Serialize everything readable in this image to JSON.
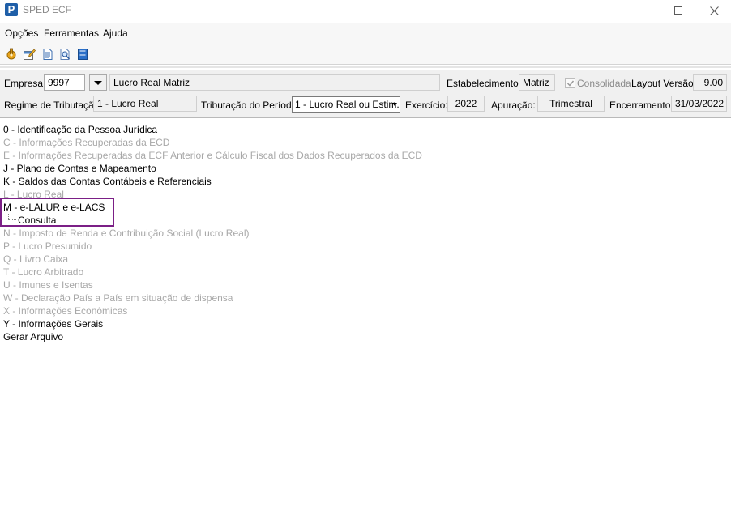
{
  "window": {
    "title": "SPED ECF",
    "app_icon_letter": "P"
  },
  "menu": {
    "items": [
      "Opções",
      "Ferramentas",
      "Ajuda"
    ]
  },
  "toolbar": {
    "icons": [
      "tools-icon",
      "edit-icon",
      "document-icon",
      "search-document-icon",
      "list-icon"
    ]
  },
  "header": {
    "empresa_label": "Empresa:",
    "empresa_code": "9997",
    "empresa_name": "Lucro Real Matriz",
    "estabelecimento_label": "Estabelecimento:",
    "estabelecimento_value": "Matriz",
    "consolidada_label": "Consolidada",
    "consolidada_checked": true,
    "layout_label": "Layout Versão:",
    "layout_value": "9.00",
    "regime_label": "Regime de Tributação:",
    "regime_value": "1 - Lucro Real",
    "tributacao_label": "Tributação do Período:",
    "tributacao_value": "1 - Lucro Real ou Estim.",
    "exercicio_label": "Exercício:",
    "exercicio_value": "2022",
    "apuracao_label": "Apuração:",
    "apuracao_value": "Trimestral",
    "encerramento_label": "Encerramento:",
    "encerramento_value": "31/03/2022"
  },
  "tree": {
    "items": [
      {
        "label": "0 - Identificação da Pessoa Jurídica",
        "enabled": true
      },
      {
        "label": "C - Informações Recuperadas da ECD",
        "enabled": false
      },
      {
        "label": "E - Informações Recuperadas da ECF Anterior e Cálculo Fiscal dos Dados Recuperados da ECD",
        "enabled": false
      },
      {
        "label": "J - Plano de Contas e Mapeamento",
        "enabled": true
      },
      {
        "label": "K - Saldos das Contas Contábeis e Referenciais",
        "enabled": true
      },
      {
        "label": "L - Lucro Real",
        "enabled": false
      },
      {
        "label": "M - e-LALUR e e-LACS",
        "enabled": true
      },
      {
        "label": "N - Imposto de Renda e Contribuição Social (Lucro Real)",
        "enabled": false
      },
      {
        "label": "P - Lucro Presumido",
        "enabled": false
      },
      {
        "label": "Q - Livro Caixa",
        "enabled": false
      },
      {
        "label": "T - Lucro Arbitrado",
        "enabled": false
      },
      {
        "label": "U - Imunes e Isentas",
        "enabled": false
      },
      {
        "label": "W - Declaração País a País em situação de dispensa",
        "enabled": false
      },
      {
        "label": "X - Informações Econômicas",
        "enabled": false
      },
      {
        "label": "Y - Informações Gerais",
        "enabled": true
      },
      {
        "label": "Gerar Arquivo",
        "enabled": true
      }
    ],
    "m_child": "Consulta"
  },
  "colors": {
    "highlight": "#7b1f86",
    "disabled_text": "#a8a8a8",
    "panel_bg": "#f0f0f0"
  }
}
